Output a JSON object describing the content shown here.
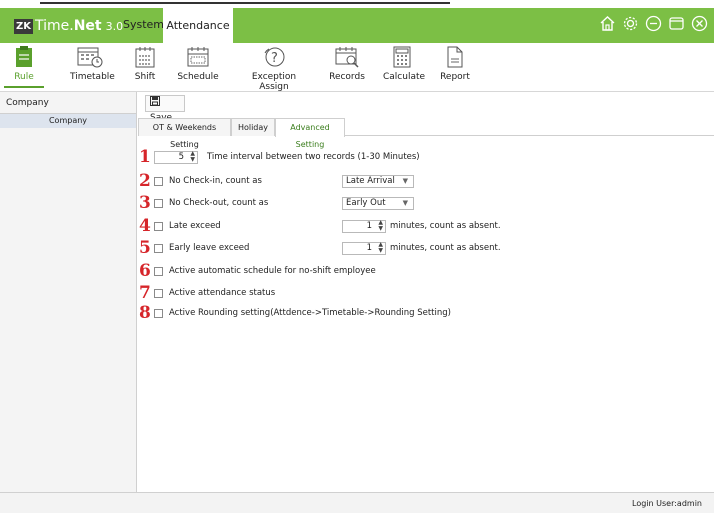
{
  "app": {
    "logo_mark": "ZK",
    "name_prefix": "Time.",
    "name_bold": "Net",
    "version": "3.0"
  },
  "menu": {
    "system": "System",
    "attendance": "Attendance"
  },
  "toolbar": [
    {
      "label": "Rule",
      "icon": "clipboard-icon"
    },
    {
      "label": "Timetable",
      "icon": "calendar-clock-icon"
    },
    {
      "label": "Shift",
      "icon": "calendar-icon"
    },
    {
      "label": "Schedule",
      "icon": "schedule-icon"
    },
    {
      "label": "Exception Assign",
      "icon": "question-icon"
    },
    {
      "label": "Records",
      "icon": "search-calendar-icon"
    },
    {
      "label": "Calculate",
      "icon": "calculator-icon"
    },
    {
      "label": "Report",
      "icon": "document-icon"
    }
  ],
  "sidebar": {
    "title": "Company",
    "items": [
      "Company"
    ]
  },
  "actions": {
    "save": "Save"
  },
  "tabs": [
    "OT & Weekends Setting",
    "Holiday",
    "Advanced Setting"
  ],
  "active_tab": "Advanced Setting",
  "settings": {
    "interval": {
      "num": "1",
      "value": "5",
      "label": "Time interval between two records (1-30 Minutes)"
    },
    "no_checkin": {
      "num": "2",
      "label": "No Check-in, count as",
      "value": "Late Arrival"
    },
    "no_checkout": {
      "num": "3",
      "label": "No Check-out, count as",
      "value": "Early Out"
    },
    "late_exceed": {
      "num": "4",
      "label": "Late exceed",
      "value": "1",
      "suffix": "minutes, count as absent."
    },
    "early_exceed": {
      "num": "5",
      "label": "Early leave exceed",
      "value": "1",
      "suffix": "minutes, count as absent."
    },
    "auto_schedule": {
      "num": "6",
      "label": "Active automatic schedule for no-shift employee"
    },
    "attendance_status": {
      "num": "7",
      "label": "Active attendance status"
    },
    "rounding": {
      "num": "8",
      "label": "Active Rounding setting(Attdence->Timetable->Rounding Setting)"
    }
  },
  "status": {
    "login": "Login User:admin"
  },
  "colors": {
    "brand_green": "#7cbf45",
    "accent_red": "#d6252a",
    "active_tab_text": "#3a7d1c"
  }
}
